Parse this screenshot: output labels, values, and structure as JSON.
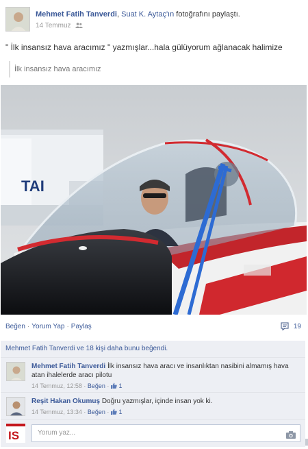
{
  "post": {
    "actor": "Mehmet Fatih Tanverdi",
    "sep": ", ",
    "friend": "Suat K. Aytaç'ın",
    "action_text": " fotoğrafını paylaştı.",
    "date": "14 Temmuz",
    "audience_icon": "people-icon",
    "message": "\" İlk insansız hava aracımız \" yazmışlar...hala gülüyorum ağlanacak halimize",
    "quote": "İlk insansız hava aracımız",
    "photo_sign_text": "TAI"
  },
  "actions": {
    "like": "Beğen",
    "comment": "Yorum Yap",
    "share": "Paylaş",
    "dot": "·",
    "comment_count": "19",
    "comment_icon": "comment-icon"
  },
  "likes_text": "Mehmet Fatih Tanverdi ve 18 kişi daha bunu beğendi.",
  "comments": [
    {
      "author": "Mehmet Fatih Tanverdi",
      "text": "İlk insansız hava aracı ve insanlıktan nasibini almamış hava atan ihalelerde aracı pilotu",
      "time": "14 Temmuz, 12:58",
      "like": "Beğen",
      "likes": "1"
    },
    {
      "author": "Reşit Hakan Okumuş",
      "text": "Doğru yazmışlar, içinde insan yok ki.",
      "time": "14 Temmuz, 13:34",
      "like": "Beğen",
      "likes": "1"
    }
  ],
  "reply": {
    "placeholder": "Yorum yaz...",
    "avatar_text": "IS",
    "camera_icon": "camera-icon"
  },
  "colors": {
    "link": "#3b5998",
    "panel": "#edeff4",
    "text": "#333333",
    "meta": "#999999"
  }
}
